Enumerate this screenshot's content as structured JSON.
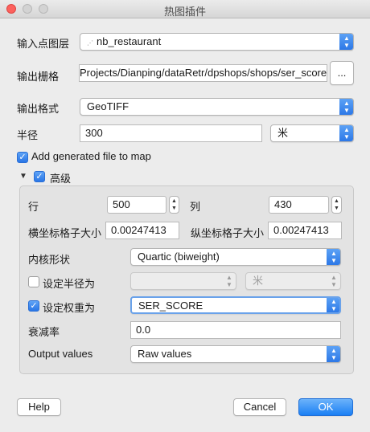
{
  "window": {
    "title": "热图插件"
  },
  "form": {
    "input_layer": {
      "label": "输入点图层",
      "value": "nb_restaurant",
      "icon": "point-layer-icon"
    },
    "output_raster": {
      "label": "输出栅格",
      "value": "Projects/Dianping/dataRetr/dpshops/shops/ser_score",
      "browse_label": "..."
    },
    "output_format": {
      "label": "输出格式",
      "value": "GeoTIFF"
    },
    "radius": {
      "label": "半径",
      "value": "300",
      "unit": "米"
    },
    "add_to_map": {
      "label": "Add generated file to map",
      "checked": true
    }
  },
  "advanced": {
    "label": "高级",
    "checked": true,
    "rows": {
      "label": "行",
      "value": "500"
    },
    "cols": {
      "label": "列",
      "value": "430"
    },
    "cell_x": {
      "label": "横坐标格子大小",
      "value": "0.00247413"
    },
    "cell_y": {
      "label": "纵坐标格子大小",
      "value": "0.00247413"
    },
    "kernel": {
      "label": "内核形状",
      "value": "Quartic (biweight)"
    },
    "radius_from": {
      "label": "设定半径为",
      "checked": false,
      "value": "",
      "unit": "米"
    },
    "weight_from": {
      "label": "设定权重为",
      "checked": true,
      "value": "SER_SCORE"
    },
    "decay": {
      "label": "衰减率",
      "value": "0.0"
    },
    "output_values": {
      "label": "Output values",
      "value": "Raw values"
    }
  },
  "buttons": {
    "help": "Help",
    "cancel": "Cancel",
    "ok": "OK"
  },
  "colors": {
    "accent": "#2a76e6",
    "close": "#fc615d"
  }
}
